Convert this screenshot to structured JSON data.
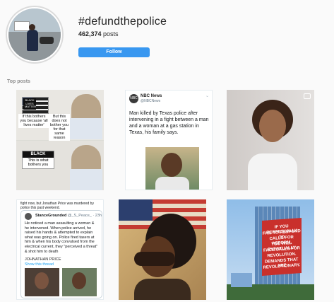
{
  "hashtag": {
    "title": "#defundthepolice",
    "post_count_number": "462,374",
    "post_count_suffix": " posts",
    "follow_label": "Follow"
  },
  "section": {
    "top_posts_label": "Top posts"
  },
  "posts": {
    "p1": {
      "flag_caption": "BLACK LIVES MATTER",
      "cap1": "If this bothers you because 'all lives matter'",
      "cap2": "But this does not bother you for that same reason",
      "black_word": "BLACK",
      "black_caption": "This is what bothers you"
    },
    "p2": {
      "source_name": "NBC News",
      "source_handle": "@NBCNews",
      "logo_text": "NBC",
      "text": "Man killed by Texas police after intervening in a fight between a man and a woman at a gas station in Texas, his family says."
    },
    "p4": {
      "top_text": "fight now, but Jonathan Price was murdered by police this past weekend.",
      "quote_name": "StanceGrounded",
      "quote_meta": "@_S_Peace_ · 23h",
      "quote_text": "He noticed a man assaulting a woman & he intervened. When police arrived, he raised his hands & attempted to explain what was going on. Police fired tasers at him & when his body convulsed from the electrical current, they \"perceived a threat\" & shot him to death",
      "quote_sub": "JOHNATHAN PRICE",
      "show_thread": "Show this thread"
    },
    "p6": {
      "sign_lines": [
        "IF YOU PERPETUALLY",
        "FAIL TO RESPOND TO",
        "CALLS FOR REFORM,",
        "YOU WILL EVENTUALLY",
        "FACE CALLS FOR",
        "REVOLUTION.",
        "DEMANDS THAT ARE",
        "REVOLUTIONARY."
      ]
    }
  },
  "colors": {
    "follow_bg": "#3897f0",
    "muted": "#8e8e8e",
    "link": "#1da1f2"
  }
}
